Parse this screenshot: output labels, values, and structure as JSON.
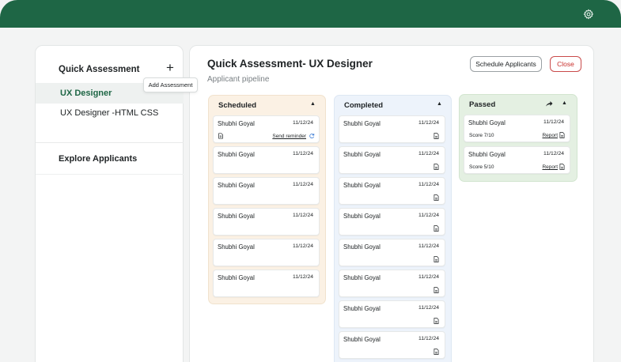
{
  "topbar": {
    "settings_icon": "gear-icon",
    "color": "#1e6645"
  },
  "sidebar": {
    "heading": "Quick Assessment",
    "add_label": "+",
    "tooltip": "Add Assessment",
    "items": [
      {
        "label": "UX Designer",
        "active": true
      },
      {
        "label": "UX Designer -HTML CSS",
        "active": false
      }
    ],
    "explore": "Explore Applicants"
  },
  "main": {
    "title": "Quick Assessment- UX Designer",
    "subtitle": "Applicant pipeline",
    "schedule_button": "Schedule Applicants",
    "close_button": "Close"
  },
  "columns": {
    "scheduled": {
      "title": "Scheduled",
      "color": "#fbf1e4",
      "cards": [
        {
          "name": "Shubhi Goyal",
          "date": "11/12/24",
          "reminder": "Send reminder"
        },
        {
          "name": "Shubhi Goyal",
          "date": "11/12/24"
        },
        {
          "name": "Shubhi Goyal",
          "date": "11/12/24"
        },
        {
          "name": "Shubhi Goyal",
          "date": "11/12/24"
        },
        {
          "name": "Shubhi Goyal",
          "date": "11/12/24"
        },
        {
          "name": "Shubhi Goyal",
          "date": "11/12/24"
        }
      ]
    },
    "completed": {
      "title": "Completed",
      "color": "#edf3fb",
      "cards": [
        {
          "name": "Shubhi Goyal",
          "date": "11/12/24"
        },
        {
          "name": "Shubhi Goyal",
          "date": "11/12/24"
        },
        {
          "name": "Shubhi Goyal",
          "date": "11/12/24"
        },
        {
          "name": "Shubhi Goyal",
          "date": "11/12/24"
        },
        {
          "name": "Shubhi Goyal",
          "date": "11/12/24"
        },
        {
          "name": "Shubhi Goyal",
          "date": "11/12/24"
        },
        {
          "name": "Shubhi Goyal",
          "date": "11/12/24"
        },
        {
          "name": "Shubhi Goyal",
          "date": "11/12/24"
        }
      ]
    },
    "passed": {
      "title": "Passed",
      "color": "#e4f0e2",
      "cards": [
        {
          "name": "Shubhi Goyal",
          "date": "11/12/24",
          "score": "Score 7/10",
          "report": "Report"
        },
        {
          "name": "Shubhi Goyal",
          "date": "11/12/24",
          "score": "Score 5/10",
          "report": "Report"
        }
      ]
    }
  }
}
